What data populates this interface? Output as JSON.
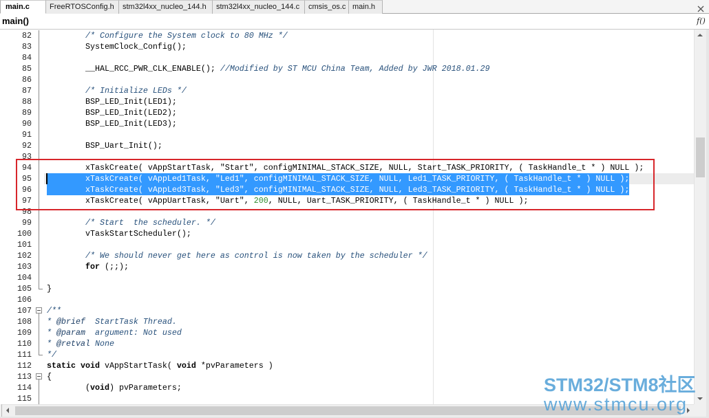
{
  "tabs": [
    {
      "label": "main.c",
      "active": true
    },
    {
      "label": "FreeRTOSConfig.h",
      "active": false
    },
    {
      "label": "stm32l4xx_nucleo_144.h",
      "active": false
    },
    {
      "label": "stm32l4xx_nucleo_144.c",
      "active": false
    },
    {
      "label": "cmsis_os.c",
      "active": false
    },
    {
      "label": "main.h",
      "active": false
    }
  ],
  "icons": {
    "tab_close": "close-icon",
    "function_list": "function-list-icon",
    "scroll_up": "scroll-up-arrow-icon",
    "scroll_down": "scroll-down-arrow-icon",
    "scroll_left": "scroll-left-arrow-icon",
    "scroll_right": "scroll-right-arrow-icon"
  },
  "function_bar": {
    "current_function": "main()",
    "function_list_button": "f()"
  },
  "editor": {
    "selected_lines": [
      95,
      96
    ],
    "cursor_line": 95,
    "annotation_box": {
      "from_line": 94,
      "to_line": 97
    },
    "lines": [
      {
        "n": 82,
        "fold": "fold-line-icon",
        "tokens": [
          {
            "comment": "        /* Configure the System clock to 80 MHz */"
          }
        ]
      },
      {
        "n": 83,
        "fold": "fold-line-icon",
        "tokens": [
          {
            "plain": "        SystemClock_Config();"
          }
        ]
      },
      {
        "n": 84,
        "fold": "fold-line-icon",
        "tokens": []
      },
      {
        "n": 85,
        "fold": "fold-line-icon",
        "tokens": [
          {
            "plain": "        __HAL_RCC_PWR_CLK_ENABLE(); "
          },
          {
            "comment": "//Modified by ST MCU China Team, Added by JWR 2018.01.29"
          }
        ]
      },
      {
        "n": 86,
        "fold": "fold-line-icon",
        "tokens": []
      },
      {
        "n": 87,
        "fold": "fold-line-icon",
        "tokens": [
          {
            "comment": "        /* Initialize LEDs */"
          }
        ]
      },
      {
        "n": 88,
        "fold": "fold-line-icon",
        "tokens": [
          {
            "plain": "        BSP_LED_Init(LED1);"
          }
        ]
      },
      {
        "n": 89,
        "fold": "fold-line-icon",
        "tokens": [
          {
            "plain": "        BSP_LED_Init(LED2);"
          }
        ]
      },
      {
        "n": 90,
        "fold": "fold-line-icon",
        "tokens": [
          {
            "plain": "        BSP_LED_Init(LED3);"
          }
        ]
      },
      {
        "n": 91,
        "fold": "fold-line-icon",
        "tokens": []
      },
      {
        "n": 92,
        "fold": "fold-line-icon",
        "tokens": [
          {
            "plain": "        BSP_Uart_Init();"
          }
        ]
      },
      {
        "n": 93,
        "fold": "fold-line-icon",
        "tokens": []
      },
      {
        "n": 94,
        "fold": "fold-line-icon",
        "tokens": [
          {
            "plain": "        xTaskCreate( vAppStartTask, \"Start\", configMINIMAL_STACK_SIZE, NULL, Start_TASK_PRIORITY, ( TaskHandle_t * ) NULL );"
          }
        ]
      },
      {
        "n": 95,
        "fold": "fold-line-icon",
        "tokens": [
          {
            "plain": "        xTaskCreate( vAppLed1Task, \"Led1\", configMINIMAL_STACK_SIZE, NULL, Led1_TASK_PRIORITY, ( TaskHandle_t * ) NULL );"
          }
        ]
      },
      {
        "n": 96,
        "fold": "fold-line-icon",
        "tokens": [
          {
            "plain": "        xTaskCreate( vAppLed3Task, \"Led3\", configMINIMAL_STACK_SIZE, NULL, Led3_TASK_PRIORITY, ( TaskHandle_t * ) NULL );"
          }
        ]
      },
      {
        "n": 97,
        "fold": "fold-line-icon",
        "tokens": [
          {
            "plain": "        xTaskCreate( vAppUartTask, \"Uart\", "
          },
          {
            "number": "200"
          },
          {
            "plain": ", NULL, Uart_TASK_PRIORITY, ( TaskHandle_t * ) NULL );"
          }
        ]
      },
      {
        "n": 98,
        "fold": "fold-line-icon",
        "tokens": []
      },
      {
        "n": 99,
        "fold": "fold-line-icon",
        "tokens": [
          {
            "comment": "        /* Start  the scheduler. */"
          }
        ]
      },
      {
        "n": 100,
        "fold": "fold-line-icon",
        "tokens": [
          {
            "plain": "        vTaskStartScheduler();"
          }
        ]
      },
      {
        "n": 101,
        "fold": "fold-line-icon",
        "tokens": []
      },
      {
        "n": 102,
        "fold": "fold-line-icon",
        "tokens": [
          {
            "comment": "        /* We should never get here as control is now taken by the scheduler */"
          }
        ]
      },
      {
        "n": 103,
        "fold": "fold-line-icon",
        "tokens": [
          {
            "plain": "        "
          },
          {
            "keyword": "for"
          },
          {
            "plain": " (;;);"
          }
        ]
      },
      {
        "n": 104,
        "fold": "fold-line-icon",
        "tokens": []
      },
      {
        "n": 105,
        "fold": "fold-end-icon",
        "tokens": [
          {
            "plain": "}"
          }
        ]
      },
      {
        "n": 106,
        "tokens": []
      },
      {
        "n": 107,
        "fold": "fold-collapse-icon",
        "tokens": [
          {
            "comment": "/**"
          }
        ]
      },
      {
        "n": 108,
        "fold": "fold-line-icon",
        "tokens": [
          {
            "comment": "* "
          },
          {
            "doctag": "@brief"
          },
          {
            "comment": "  StartTask Thread."
          }
        ]
      },
      {
        "n": 109,
        "fold": "fold-line-icon",
        "tokens": [
          {
            "comment": "* "
          },
          {
            "doctag": "@param"
          },
          {
            "comment": "  argument: Not used"
          }
        ]
      },
      {
        "n": 110,
        "fold": "fold-line-icon",
        "tokens": [
          {
            "comment": "* "
          },
          {
            "doctag": "@retval"
          },
          {
            "comment": " None"
          }
        ]
      },
      {
        "n": 111,
        "fold": "fold-end-icon",
        "tokens": [
          {
            "comment": "*/"
          }
        ]
      },
      {
        "n": 112,
        "tokens": [
          {
            "keyword": "static void"
          },
          {
            "plain": " vAppStartTask( "
          },
          {
            "keyword": "void"
          },
          {
            "plain": " *pvParameters )"
          }
        ]
      },
      {
        "n": 113,
        "fold": "fold-collapse-icon",
        "tokens": [
          {
            "plain": "{"
          }
        ]
      },
      {
        "n": 114,
        "fold": "fold-line-icon",
        "tokens": [
          {
            "plain": "        ("
          },
          {
            "keyword": "void"
          },
          {
            "plain": ") pvParameters;"
          }
        ]
      },
      {
        "n": 115,
        "fold": "fold-line-icon",
        "tokens": []
      }
    ]
  },
  "colors": {
    "comment": "#27507b",
    "doctag": "#1d3f66",
    "number": "#2e8b2e",
    "selection": "#3399ff",
    "annotation_box": "#d7262b",
    "watermark": "#4f9fd6"
  },
  "watermark": {
    "line1": "STM32/STM8社区",
    "line2": "www.stmcu.org"
  }
}
